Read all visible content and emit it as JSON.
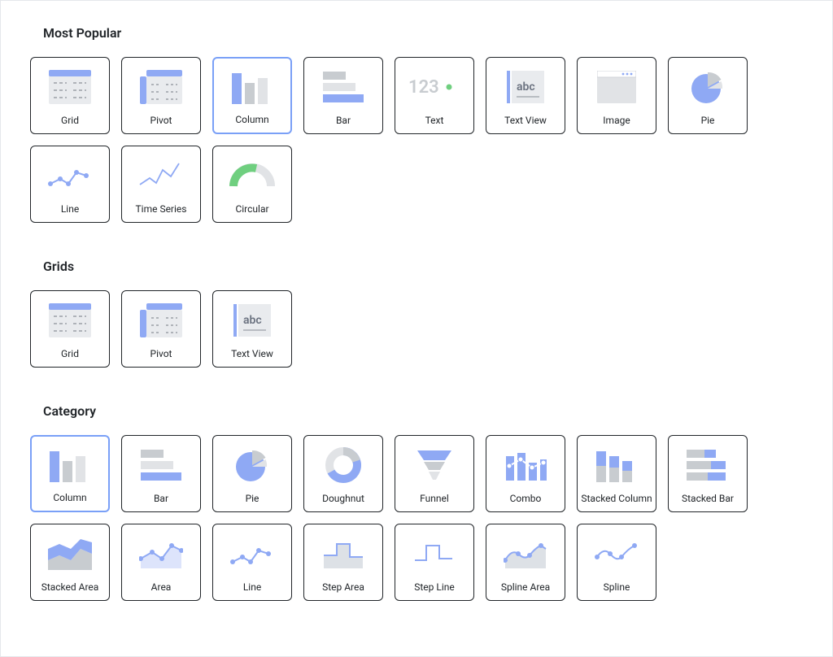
{
  "sections": {
    "most_popular": {
      "header": "Most Popular",
      "cards": {
        "grid": "Grid",
        "pivot": "Pivot",
        "column": "Column",
        "bar": "Bar",
        "text": "Text",
        "textview": "Text View",
        "image": "Image",
        "pie": "Pie",
        "line": "Line",
        "timeseries": "Time Series",
        "circular": "Circular"
      }
    },
    "grids": {
      "header": "Grids",
      "cards": {
        "grid": "Grid",
        "pivot": "Pivot",
        "textview": "Text View"
      }
    },
    "category": {
      "header": "Category",
      "cards": {
        "column": "Column",
        "bar": "Bar",
        "pie": "Pie",
        "doughnut": "Doughnut",
        "funnel": "Funnel",
        "combo": "Combo",
        "stacked_column": "Stacked Column",
        "stacked_bar": "Stacked Bar",
        "stacked_area": "Stacked Area",
        "area": "Area",
        "line": "Line",
        "step_area": "Step Area",
        "step_line": "Step Line",
        "spline_area": "Spline Area",
        "spline": "Spline"
      }
    }
  },
  "selected": [
    "most_popular.column",
    "category.column"
  ]
}
